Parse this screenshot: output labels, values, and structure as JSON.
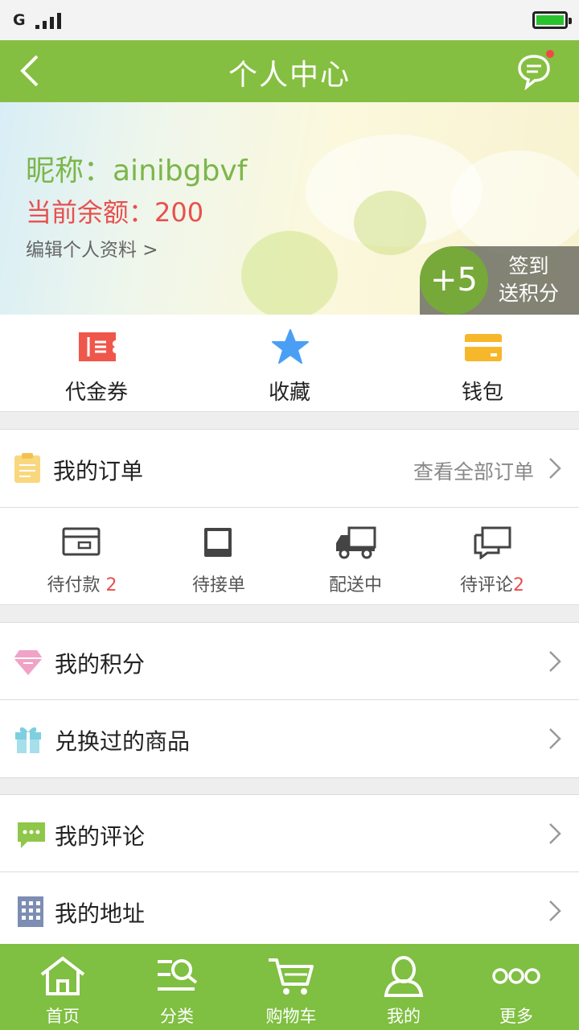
{
  "status_bar": {
    "network": "G",
    "icons": [
      "signal-icon",
      "battery-icon"
    ],
    "battery_color": "#29c22e"
  },
  "header": {
    "title": "个人中心",
    "back_icon": "back-arrow-icon",
    "message_icon": "chat-bubble-icon",
    "bg_color": "#85bf41"
  },
  "profile": {
    "nickname": "昵称：ainibgbvf",
    "balance": "当前余额：200",
    "edit_link": "编辑个人资料 >",
    "checkin": {
      "points": "+5",
      "line1": "签到",
      "line2": "送积分"
    }
  },
  "quick_actions": [
    {
      "label": "代金券",
      "icon": "voucher-icon",
      "color": "#f0574b"
    },
    {
      "label": "收藏",
      "icon": "star-icon",
      "color": "#4a9ff5"
    },
    {
      "label": "钱包",
      "icon": "wallet-icon",
      "color": "#f7b72a"
    }
  ],
  "orders": {
    "title": "我的订单",
    "view_all": "查看全部订单",
    "icon": "clipboard-icon",
    "statuses": [
      {
        "label": "待付款",
        "badge": "2",
        "icon": "card-payment-icon"
      },
      {
        "label": "待接单",
        "badge": "",
        "icon": "inbox-icon"
      },
      {
        "label": "配送中",
        "badge": "",
        "icon": "truck-icon"
      },
      {
        "label": "待评论",
        "badge": "2",
        "icon": "comments-icon"
      }
    ]
  },
  "menu_group_1": [
    {
      "label": "我的积分",
      "icon": "diamond-icon",
      "color": "#f0a3c6"
    },
    {
      "label": "兑换过的商品",
      "icon": "gift-icon",
      "color": "#7ecfe0"
    }
  ],
  "menu_group_2": [
    {
      "label": "我的评论",
      "icon": "comment-icon",
      "color": "#8fc74a"
    },
    {
      "label": "我的地址",
      "icon": "building-icon",
      "color": "#7d8db3"
    }
  ],
  "tabbar": [
    {
      "label": "首页",
      "icon": "home-icon"
    },
    {
      "label": "分类",
      "icon": "category-search-icon"
    },
    {
      "label": "购物车",
      "icon": "cart-icon"
    },
    {
      "label": "我的",
      "icon": "user-icon"
    },
    {
      "label": "更多",
      "icon": "more-icon"
    }
  ]
}
